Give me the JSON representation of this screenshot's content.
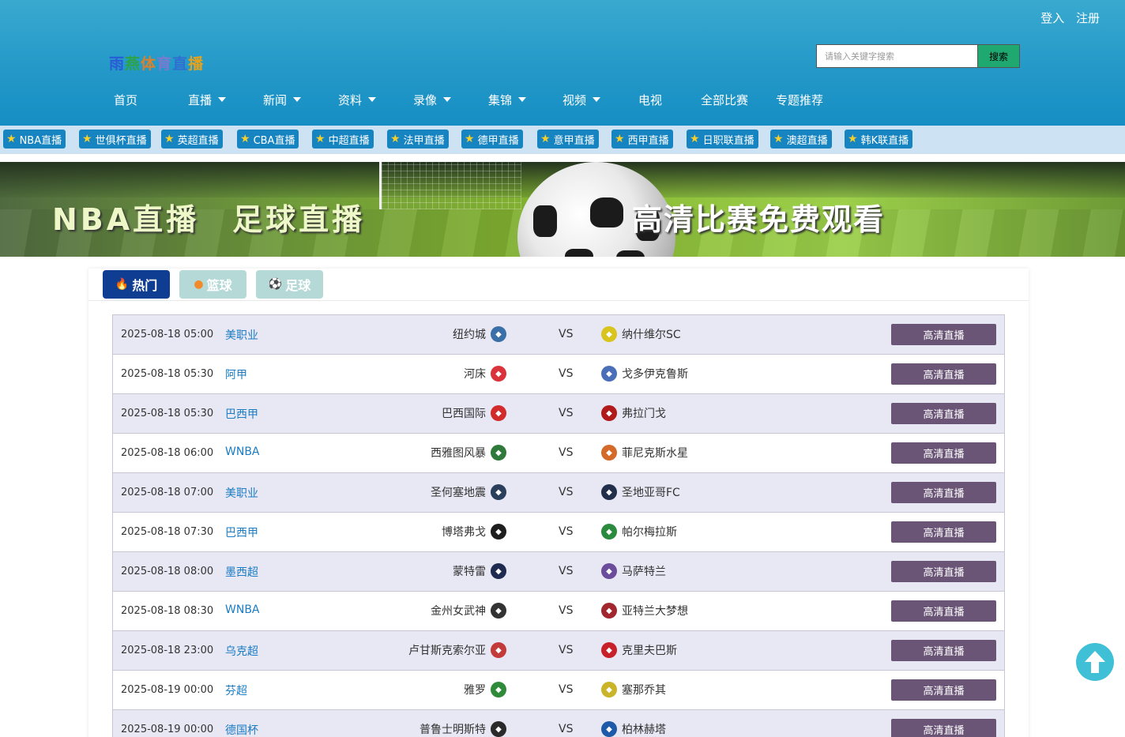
{
  "header": {
    "auth": {
      "login": "登入",
      "register": "注册"
    },
    "logo": [
      "雨",
      "燕",
      "体",
      "育",
      "直",
      "播"
    ],
    "logo_colors": [
      "#2a5bd7",
      "#2ea345",
      "#d9822b",
      "#7a7ad0",
      "#2e6fd0",
      "#e8a21a"
    ],
    "search": {
      "placeholder": "请输入关键字搜索",
      "button": "搜索"
    },
    "nav": [
      {
        "label": "首页",
        "dropdown": false
      },
      {
        "label": "直播",
        "dropdown": true
      },
      {
        "label": "新闻",
        "dropdown": true
      },
      {
        "label": "资料",
        "dropdown": true
      },
      {
        "label": "录像",
        "dropdown": true
      },
      {
        "label": "集锦",
        "dropdown": true
      },
      {
        "label": "视频",
        "dropdown": true
      },
      {
        "label": "电视",
        "dropdown": false
      },
      {
        "label": "全部比赛",
        "dropdown": false
      },
      {
        "label": "专题推荐",
        "dropdown": false
      }
    ]
  },
  "tags": [
    "NBA直播",
    "世俱杯直播",
    "英超直播",
    "CBA直播",
    "中超直播",
    "法甲直播",
    "德甲直播",
    "意甲直播",
    "西甲直播",
    "日职联直播",
    "澳超直播",
    "韩K联直播"
  ],
  "banner": {
    "left_text": "NBA直播　足球直播",
    "right_text": "高清比赛免费观看"
  },
  "tabs": [
    {
      "label": "热门",
      "icon": "fire-icon",
      "active": true
    },
    {
      "label": "篮球",
      "icon": "basketball-icon",
      "active": false
    },
    {
      "label": "足球",
      "icon": "soccer-ball-icon",
      "active": false
    }
  ],
  "matches": [
    {
      "time": "2025-08-18 05:00",
      "league": "美职业",
      "home": "纽约城",
      "away": "纳什维尔SC",
      "home_color": "#3a6fa8",
      "away_color": "#d8c41c",
      "button": "高清直播"
    },
    {
      "time": "2025-08-18 05:30",
      "league": "阿甲",
      "home": "河床",
      "away": "戈多伊克鲁斯",
      "home_color": "#d9333b",
      "away_color": "#4a6fb8",
      "button": "高清直播"
    },
    {
      "time": "2025-08-18 05:30",
      "league": "巴西甲",
      "home": "巴西国际",
      "away": "弗拉门戈",
      "home_color": "#d12b2b",
      "away_color": "#b01a1a",
      "button": "高清直播"
    },
    {
      "time": "2025-08-18 06:00",
      "league": "WNBA",
      "home": "西雅图风暴",
      "away": "菲尼克斯水星",
      "home_color": "#2f7a3a",
      "away_color": "#d36a2a",
      "button": "高清直播"
    },
    {
      "time": "2025-08-18 07:00",
      "league": "美职业",
      "home": "圣何塞地震",
      "away": "圣地亚哥FC",
      "home_color": "#2a3f5c",
      "away_color": "#222f4a",
      "button": "高清直播"
    },
    {
      "time": "2025-08-18 07:30",
      "league": "巴西甲",
      "home": "博塔弗戈",
      "away": "帕尔梅拉斯",
      "home_color": "#1e1e1e",
      "away_color": "#2a8a3e",
      "button": "高清直播"
    },
    {
      "time": "2025-08-18 08:00",
      "league": "墨西超",
      "home": "蒙特雷",
      "away": "马萨特兰",
      "home_color": "#1e2a4f",
      "away_color": "#6a4c9a",
      "button": "高清直播"
    },
    {
      "time": "2025-08-18 08:30",
      "league": "WNBA",
      "home": "金州女武神",
      "away": "亚特兰大梦想",
      "home_color": "#333333",
      "away_color": "#a1262e",
      "button": "高清直播"
    },
    {
      "time": "2025-08-18 23:00",
      "league": "乌克超",
      "home": "卢甘斯克索尔亚",
      "away": "克里夫巴斯",
      "home_color": "#c23a3a",
      "away_color": "#c8202a",
      "button": "高清直播"
    },
    {
      "time": "2025-08-19 00:00",
      "league": "芬超",
      "home": "雅罗",
      "away": "塞那乔其",
      "home_color": "#2f8a3a",
      "away_color": "#c9b42a",
      "button": "高清直播"
    },
    {
      "time": "2025-08-19 00:00",
      "league": "德国杯",
      "home": "普鲁士明斯特",
      "away": "柏林赫塔",
      "home_color": "#2a2a2a",
      "away_color": "#1f5aa8",
      "button": "高清直播"
    }
  ],
  "vs_label": "VS"
}
